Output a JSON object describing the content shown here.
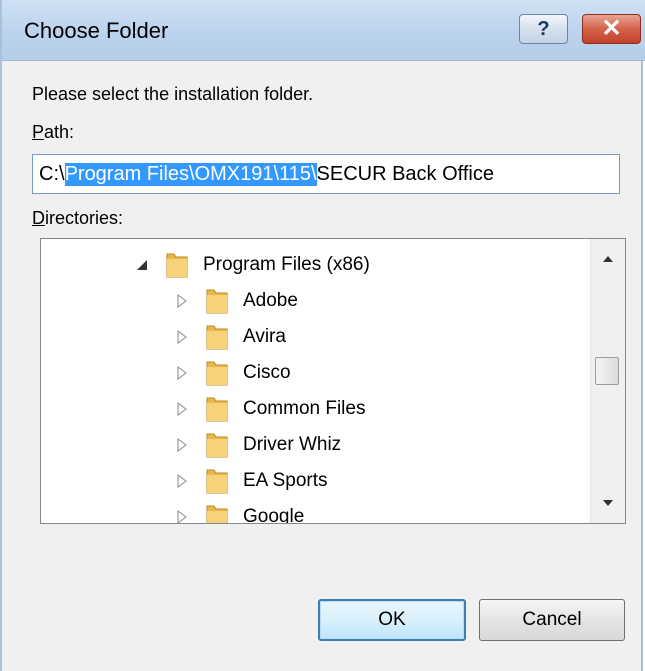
{
  "dialog": {
    "title": "Choose Folder",
    "help_button": "?",
    "close_button": "✕",
    "instruction": "Please select the installation folder.",
    "path_label_accel": "P",
    "path_label_rest": "ath:",
    "path_prefix": "C:\\",
    "path_selected": "Program Files\\OMX191\\115\\",
    "path_suffix": "SECUR Back Office",
    "directories_label_accel": "D",
    "directories_label_rest": "irectories:",
    "tree": [
      {
        "label": "Program Files (x86)",
        "expanded": true
      },
      {
        "label": "Adobe",
        "expanded": false
      },
      {
        "label": "Avira",
        "expanded": false
      },
      {
        "label": "Cisco",
        "expanded": false
      },
      {
        "label": "Common Files",
        "expanded": false
      },
      {
        "label": "Driver Whiz",
        "expanded": false
      },
      {
        "label": "EA Sports",
        "expanded": false
      },
      {
        "label": "Google",
        "expanded": false
      }
    ],
    "ok_button": "OK",
    "cancel_button": "Cancel"
  },
  "colors": {
    "selection": "#3399ff",
    "folder": "#e8b94a",
    "titlebar": "#bcd3ee",
    "close": "#c44129"
  },
  "icons": {
    "folder": "folder-icon",
    "expanded": "triangle-expanded-icon",
    "collapsed": "triangle-collapsed-icon"
  }
}
